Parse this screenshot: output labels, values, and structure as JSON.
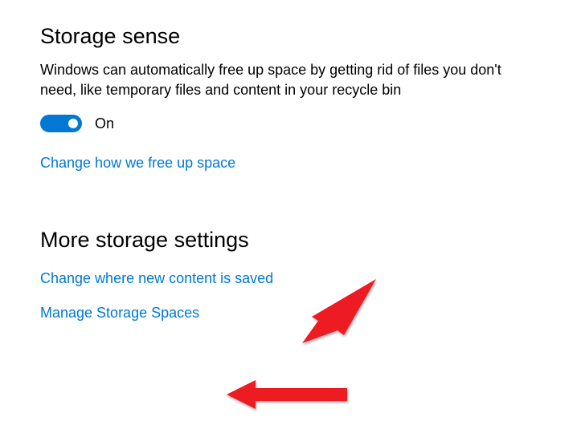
{
  "storage_sense": {
    "heading": "Storage sense",
    "description": "Windows can automatically free up space by getting rid of files you don't need, like temporary files and content in your recycle bin",
    "toggle_state": "On",
    "link_change_free_up": "Change how we free up space"
  },
  "more_storage": {
    "heading": "More storage settings",
    "link_change_content_saved": "Change where new content is saved",
    "link_manage_storage_spaces": "Manage Storage Spaces"
  }
}
